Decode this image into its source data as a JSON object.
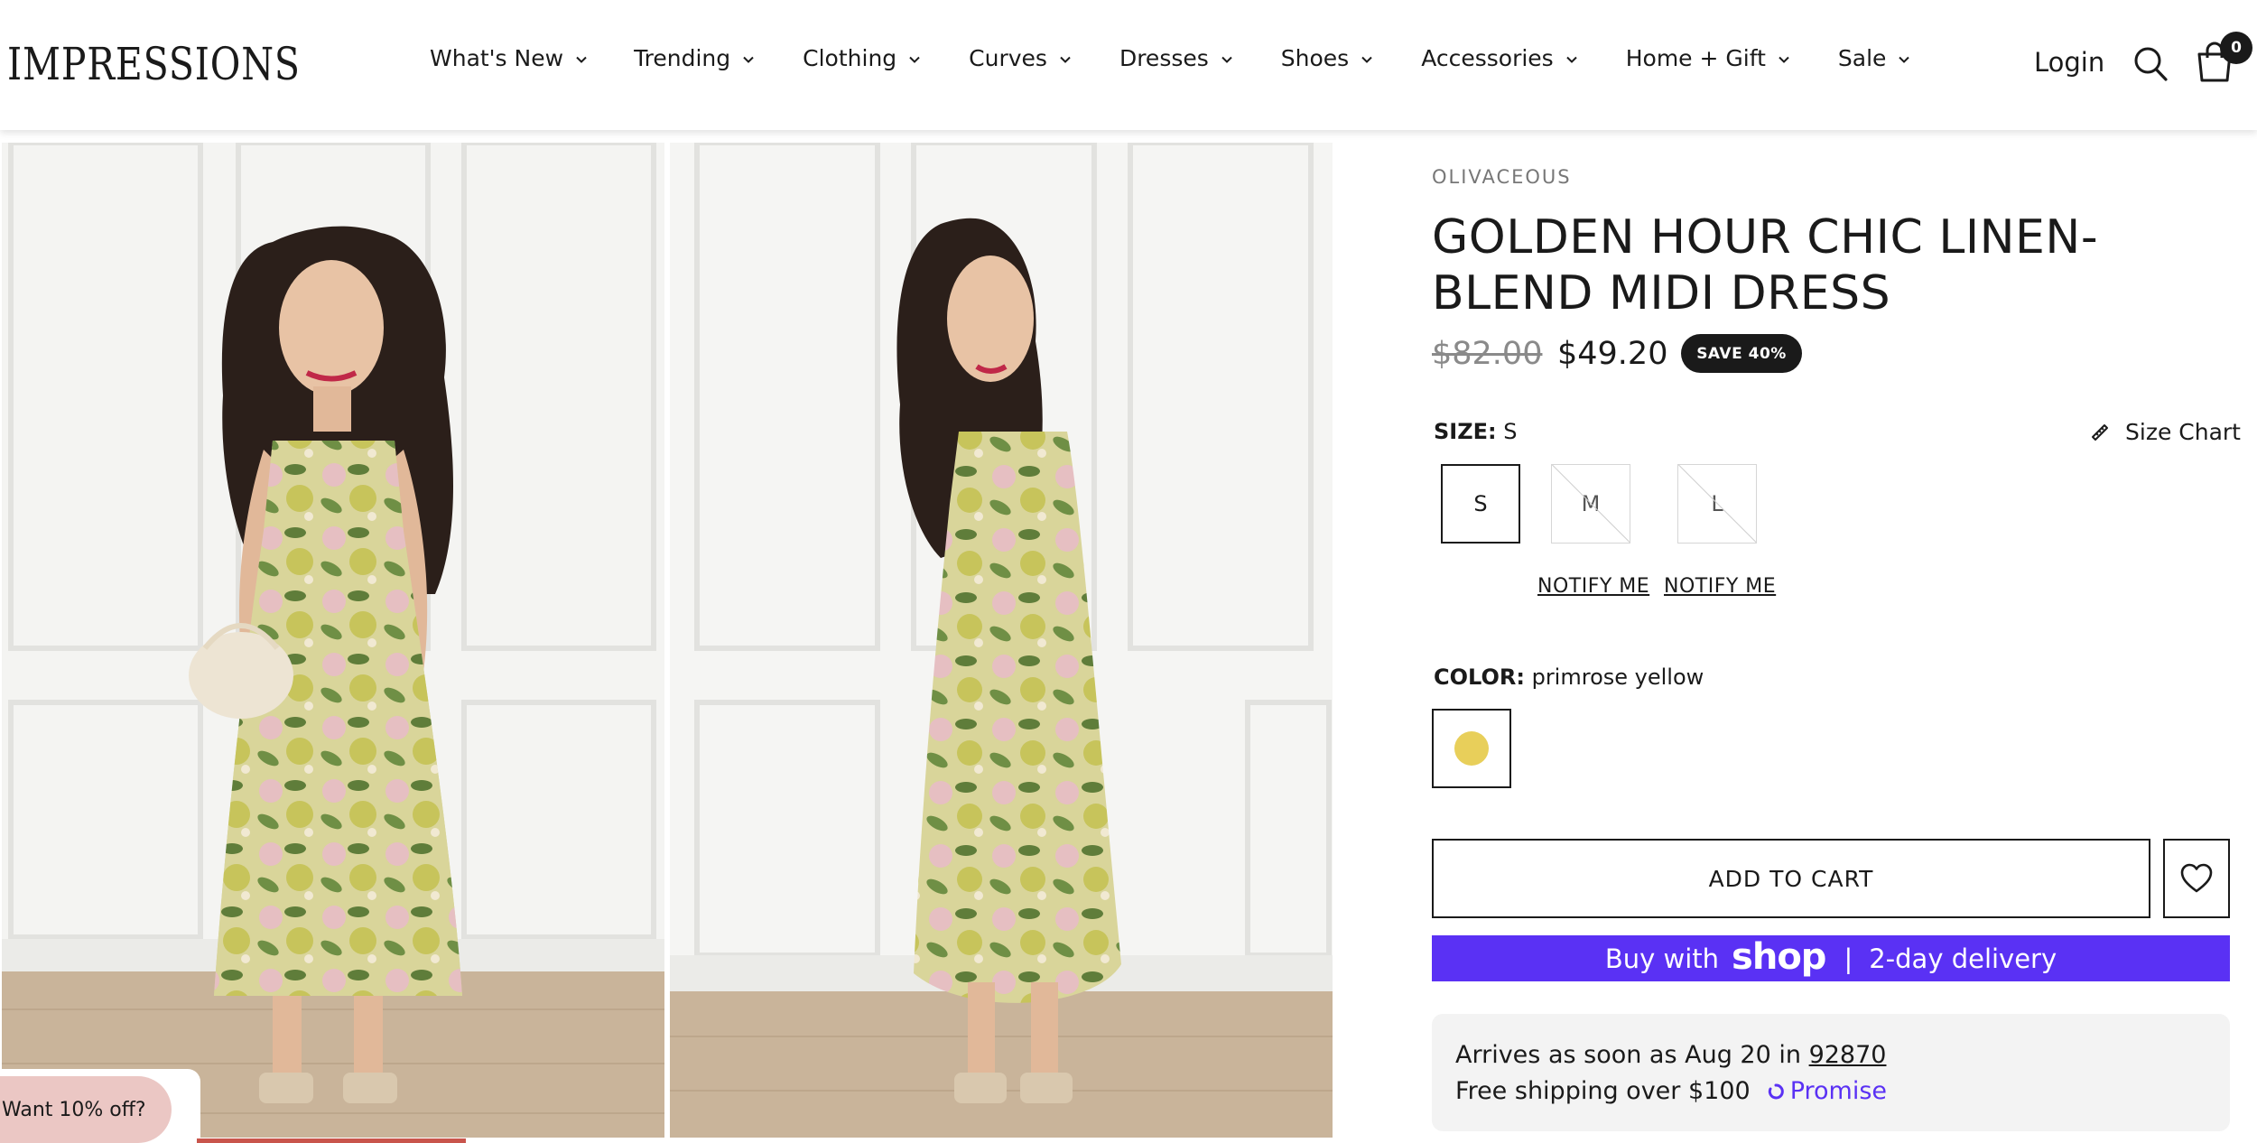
{
  "header": {
    "logo": "IMPRESSIONS",
    "nav": [
      {
        "label": "What's New"
      },
      {
        "label": "Trending"
      },
      {
        "label": "Clothing"
      },
      {
        "label": "Curves"
      },
      {
        "label": "Dresses"
      },
      {
        "label": "Shoes"
      },
      {
        "label": "Accessories"
      },
      {
        "label": "Home + Gift"
      },
      {
        "label": "Sale"
      }
    ],
    "login": "Login",
    "cart_count": "0"
  },
  "promo": {
    "label": "Want 10% off?"
  },
  "product": {
    "brand": "OLIVACEOUS",
    "title": "GOLDEN HOUR CHIC LINEN-BLEND MIDI DRESS",
    "price_original": "$82.00",
    "price_sale": "$49.20",
    "save_badge": "SAVE 40%",
    "size_label": "SIZE:",
    "size_selected": "S",
    "size_chart": "Size Chart",
    "sizes": [
      {
        "label": "S",
        "available": true
      },
      {
        "label": "M",
        "available": false
      },
      {
        "label": "L",
        "available": false
      }
    ],
    "notify_label": "NOTIFY ME",
    "color_label": "COLOR:",
    "color_selected": "primrose yellow",
    "color_swatch": "#e8cf5a",
    "add_to_cart": "ADD TO CART",
    "shop_pay": {
      "prefix": "Buy with",
      "brand": "shop",
      "suffix": "2-day delivery",
      "color": "#5a31f4"
    },
    "delivery": {
      "arrives_text": "Arrives as soon as Aug 20 in",
      "zip": "92870",
      "free_shipping": "Free shipping over $100",
      "promise": "Promise"
    }
  },
  "colors": {
    "brand_purple": "#5a31f4",
    "promo_pink": "#ebc7c4",
    "text_dark": "#1a1a1a"
  }
}
